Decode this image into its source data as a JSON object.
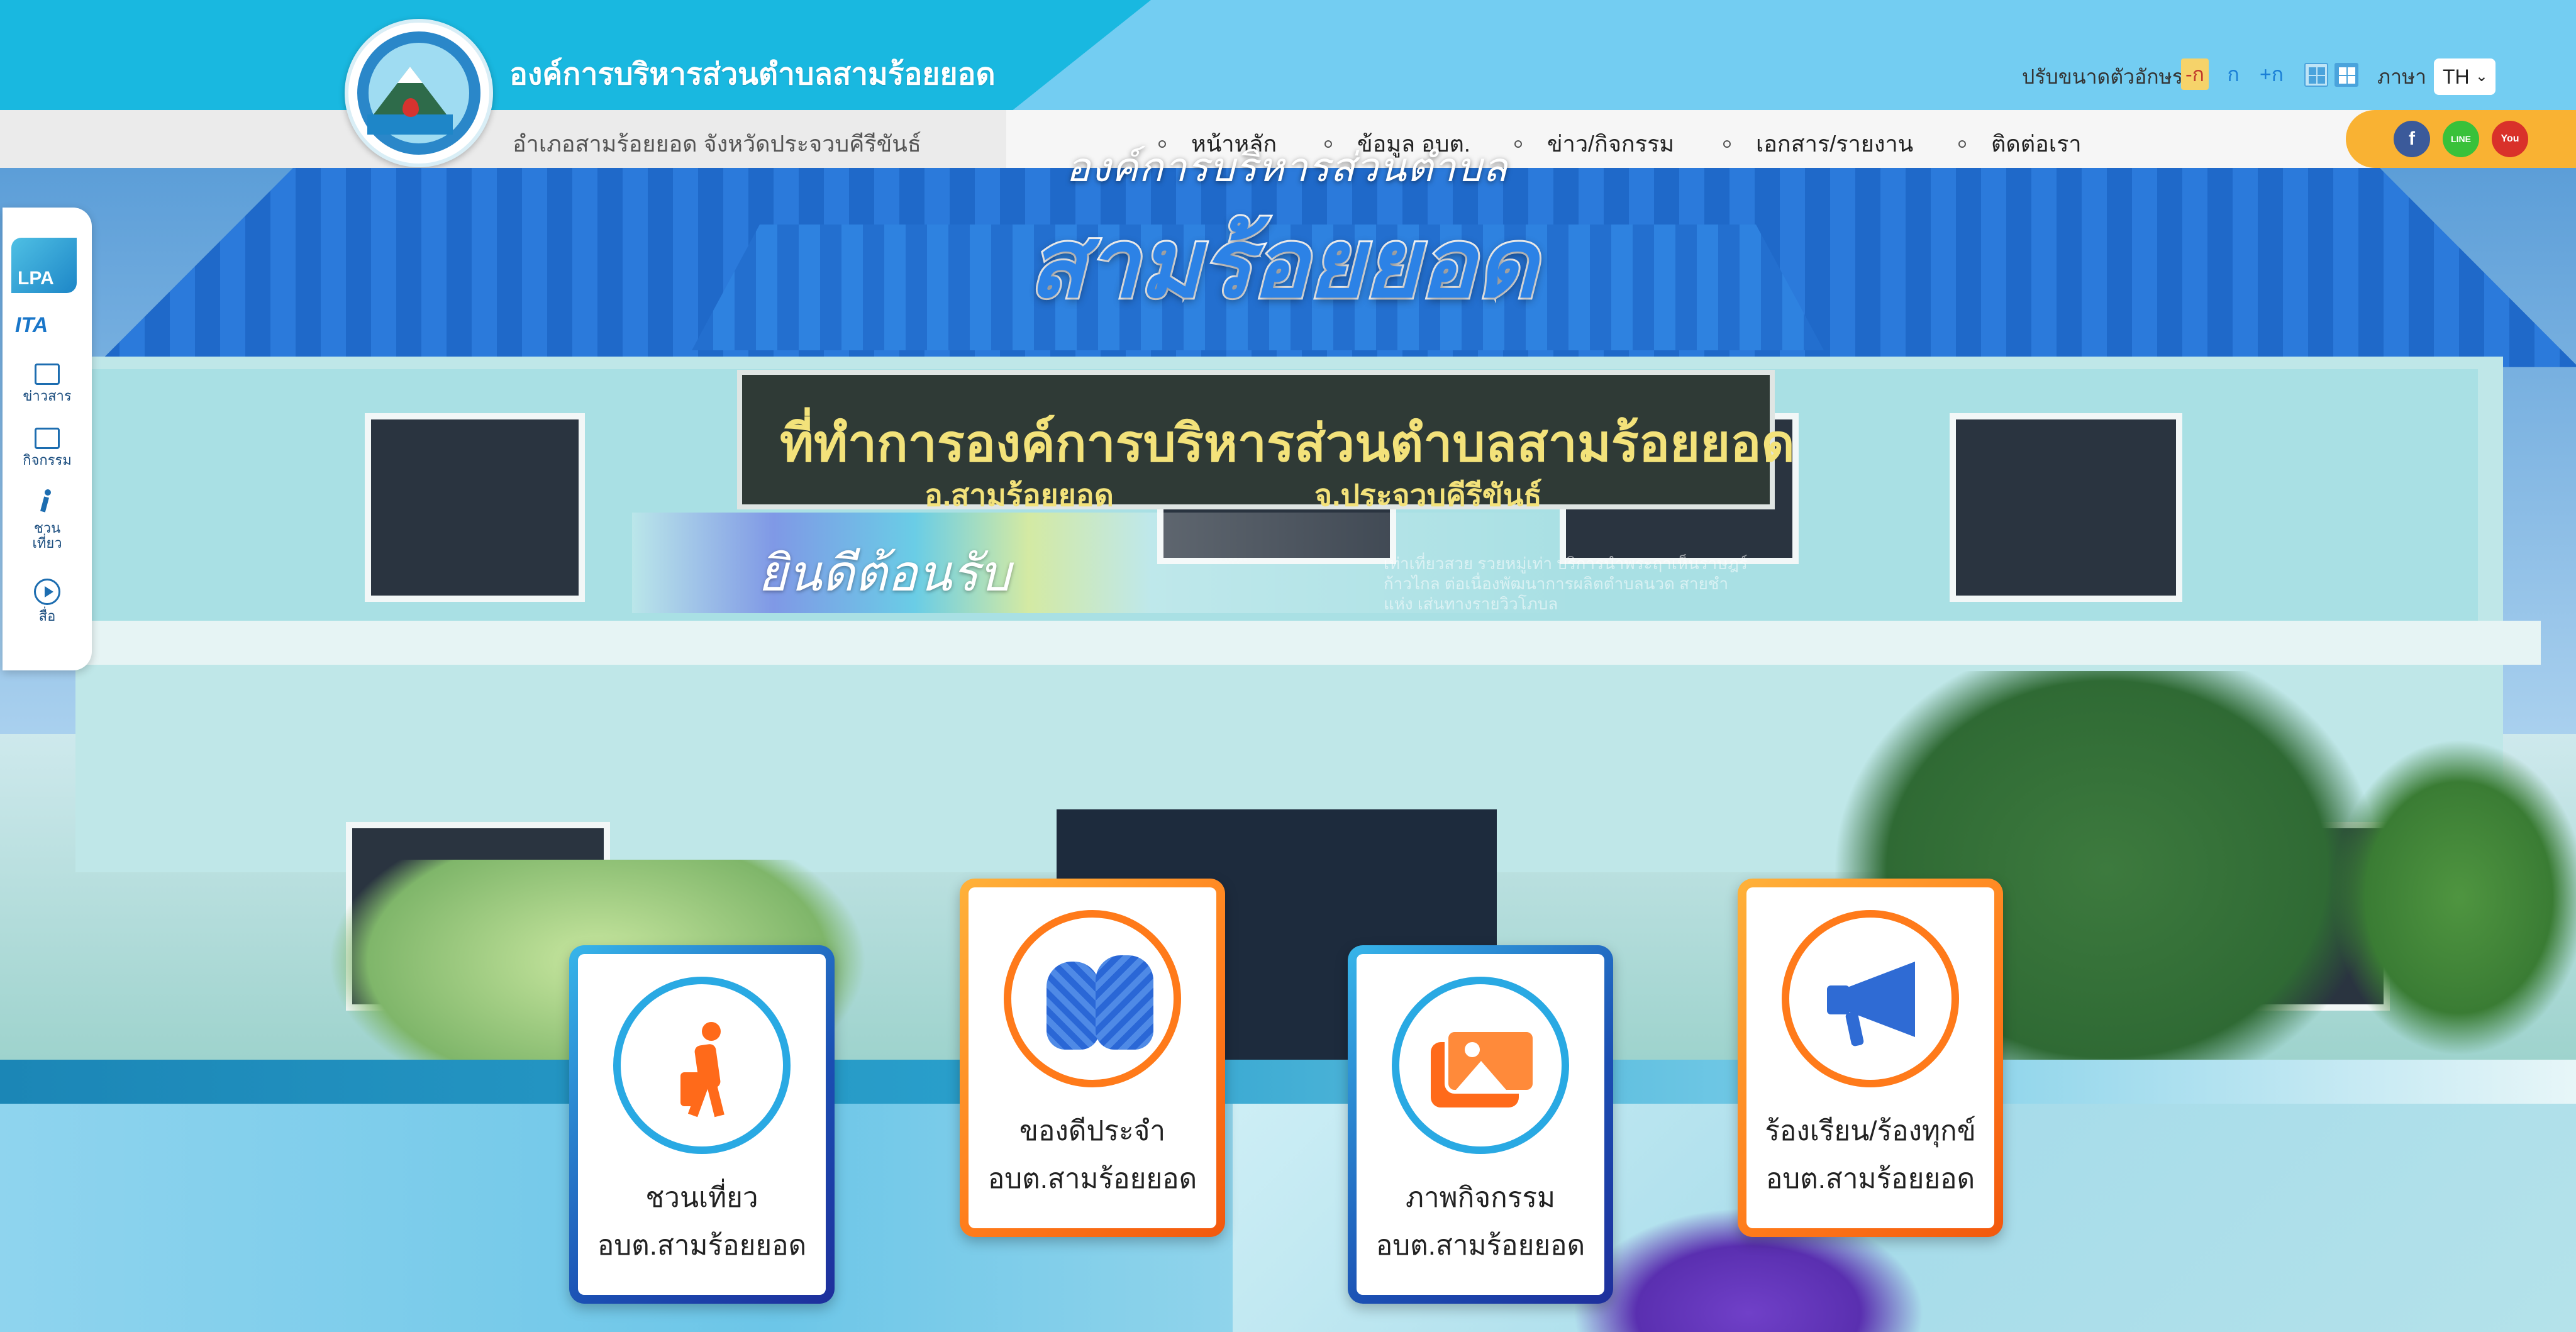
{
  "header": {
    "org_title": "องค์การบริหารส่วนตำบลสามร้อยยอด",
    "org_subtitle": "อำเภอสามร้อยยอด จังหวัดประจวบคีรีขันธ์",
    "font_size_label": "ปรับขนาดตัวอักษร",
    "font_small": "-ก",
    "font_normal": "ก",
    "font_large": "+ก",
    "language_label": "ภาษา",
    "language_value": "TH"
  },
  "nav": {
    "items": [
      "หน้าหลัก",
      "ข้อมูล อบต.",
      "ข่าว/กิจกรรม",
      "เอกสาร/รายงาน",
      "ติดต่อเรา"
    ]
  },
  "social": {
    "facebook": "f",
    "line": "LINE",
    "youtube": "You"
  },
  "side_dock": {
    "lpa": "LPA",
    "ita": "ITA",
    "items": [
      "ข่าวสาร",
      "กิจกรรม",
      "ชวน เที่ยว",
      "สื่อ"
    ]
  },
  "hero": {
    "subtitle": "องค์การบริหารส่วนตำบล",
    "title": "สามร้อยยอด",
    "sign_main": "ที่ทำการองค์การบริหารส่วนตำบลสามร้อยยอด",
    "sign_district": "อ.สามร้อยยอด",
    "sign_province": "จ.ประจวบคีรีขันธ์",
    "welcome": "ยินดีต้อนรับ",
    "welcome_desc": "เท่าเที่ยวสวย รวยหมู่เท่า บริการนำพระฤาเห็นราษฎร์ก้าวไกล ต่อเนื่องพัฒนาการผลิตตำบลนวด สายชำแห่ง เส่นทางรายวิวโภบล"
  },
  "cards": [
    {
      "line1": "ชวนเที่ยว",
      "line2": "อบต.สามร้อยยอด",
      "icon": "traveler-icon",
      "theme": "blue"
    },
    {
      "line1": "ของดีประจำ",
      "line2": "อบต.สามร้อยยอด",
      "icon": "basket-icon",
      "theme": "orange"
    },
    {
      "line1": "ภาพกิจกรรม",
      "line2": "อบต.สามร้อยยอด",
      "icon": "photo-icon",
      "theme": "blue"
    },
    {
      "line1": "ร้องเรียน/ร้องทุกข์",
      "line2": "อบต.สามร้อยยอด",
      "icon": "megaphone-icon",
      "theme": "orange"
    }
  ],
  "colors": {
    "header_blue": "#19b8e0",
    "accent_orange": "#ff7a1a",
    "accent_blue": "#29a9e3",
    "social_bar": "#f9b233"
  }
}
